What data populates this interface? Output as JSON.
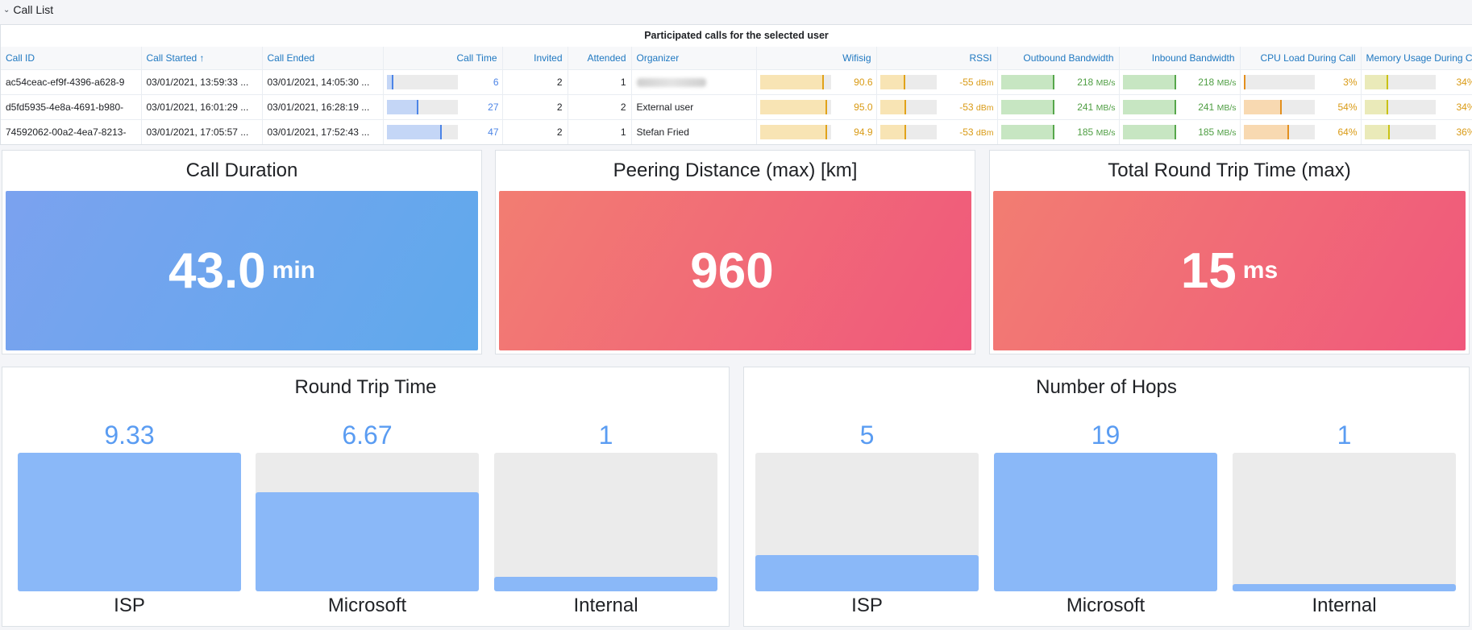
{
  "section": {
    "title": "Call List"
  },
  "table": {
    "title": "Participated calls for the selected user",
    "columns": [
      "Call ID",
      "Call Started",
      "Call Ended",
      "Call Time",
      "Invited",
      "Attended",
      "Organizer",
      "Wifisig",
      "RSSI",
      "Outbound Bandwidth",
      "Inbound Bandwidth",
      "CPU Load During Call",
      "Memory Usage During C"
    ],
    "sort_indicator": "↑",
    "rows": [
      {
        "call_id": "ac54ceac-ef9f-4396-a628-9",
        "started": "03/01/2021, 13:59:33 ...",
        "ended": "03/01/2021, 14:05:30 ...",
        "call_time": "6",
        "call_time_level": 0.1,
        "invited": "2",
        "attended": "1",
        "organizer": "",
        "organizer_blurred": true,
        "wifisig": "90.6",
        "wifisig_level": 0.906,
        "rssi": "-55",
        "rssi_unit": "dBm",
        "rssi_level": 0.45,
        "outbound": "218",
        "outbound_unit": "MB/s",
        "outbound_level": 1.0,
        "inbound": "218",
        "inbound_unit": "MB/s",
        "inbound_level": 1.0,
        "cpu": "3%",
        "cpu_level": 0.03,
        "memory": "34%",
        "memory_level": 0.34
      },
      {
        "call_id": "d5fd5935-4e8a-4691-b980-",
        "started": "03/01/2021, 16:01:29 ...",
        "ended": "03/01/2021, 16:28:19 ...",
        "call_time": "27",
        "call_time_level": 0.45,
        "invited": "2",
        "attended": "2",
        "organizer": "External user",
        "organizer_blurred": false,
        "wifisig": "95.0",
        "wifisig_level": 0.95,
        "rssi": "-53",
        "rssi_unit": "dBm",
        "rssi_level": 0.47,
        "outbound": "241",
        "outbound_unit": "MB/s",
        "outbound_level": 1.0,
        "inbound": "241",
        "inbound_unit": "MB/s",
        "inbound_level": 1.0,
        "cpu": "54%",
        "cpu_level": 0.54,
        "memory": "34%",
        "memory_level": 0.34
      },
      {
        "call_id": "74592062-00a2-4ea7-8213-",
        "started": "03/01/2021, 17:05:57 ...",
        "ended": "03/01/2021, 17:52:43 ...",
        "call_time": "47",
        "call_time_level": 0.78,
        "invited": "2",
        "attended": "1",
        "organizer": "Stefan Fried",
        "organizer_blurred": false,
        "wifisig": "94.9",
        "wifisig_level": 0.949,
        "rssi": "-53",
        "rssi_unit": "dBm",
        "rssi_level": 0.47,
        "outbound": "185",
        "outbound_unit": "MB/s",
        "outbound_level": 1.0,
        "inbound": "185",
        "inbound_unit": "MB/s",
        "inbound_level": 1.0,
        "cpu": "64%",
        "cpu_level": 0.64,
        "memory": "36%",
        "memory_level": 0.36
      }
    ]
  },
  "stats": [
    {
      "title": "Call Duration",
      "value": "43.0",
      "unit": "min",
      "color": "#6aa6ee"
    },
    {
      "title": "Peering Distance (max) [km]",
      "value": "960",
      "unit": "",
      "color": "#f2677a"
    },
    {
      "title": "Total Round Trip Time (max)",
      "value": "15",
      "unit": "ms",
      "color": "#f2677a"
    }
  ],
  "bar_gauges": [
    {
      "title": "Round Trip Time",
      "items": [
        {
          "name": "ISP",
          "value": "9.33",
          "level": 1.0
        },
        {
          "name": "Microsoft",
          "value": "6.67",
          "level": 0.715
        },
        {
          "name": "Internal",
          "value": "1",
          "level": 0.107
        }
      ]
    },
    {
      "title": "Number of Hops",
      "items": [
        {
          "name": "ISP",
          "value": "5",
          "level": 0.263
        },
        {
          "name": "Microsoft",
          "value": "19",
          "level": 1.0
        },
        {
          "name": "Internal",
          "value": "1",
          "level": 0.053
        }
      ]
    }
  ],
  "colors": {
    "link": "#1f78c1",
    "gauge_blue_fill": "#c4d6f6",
    "gauge_blue_mark": "#4c84e6",
    "gauge_blue_text": "#4c84e6",
    "gauge_yellow_fill": "#f8e4b4",
    "gauge_yellow_mark": "#e0a21a",
    "gauge_yellow_text": "#d99a14",
    "gauge_green_fill": "#c7e6c2",
    "gauge_green_mark": "#56a64b",
    "gauge_green_text": "#4f9e43",
    "gauge_orange_fill": "#f8d9b1",
    "gauge_orange_mark": "#e38f1e",
    "gauge_olive_fill": "#eaeab9",
    "gauge_olive_mark": "#c9c214",
    "bar_fill": "#8ab8f8",
    "bar_value_text": "#5a9cf2"
  }
}
